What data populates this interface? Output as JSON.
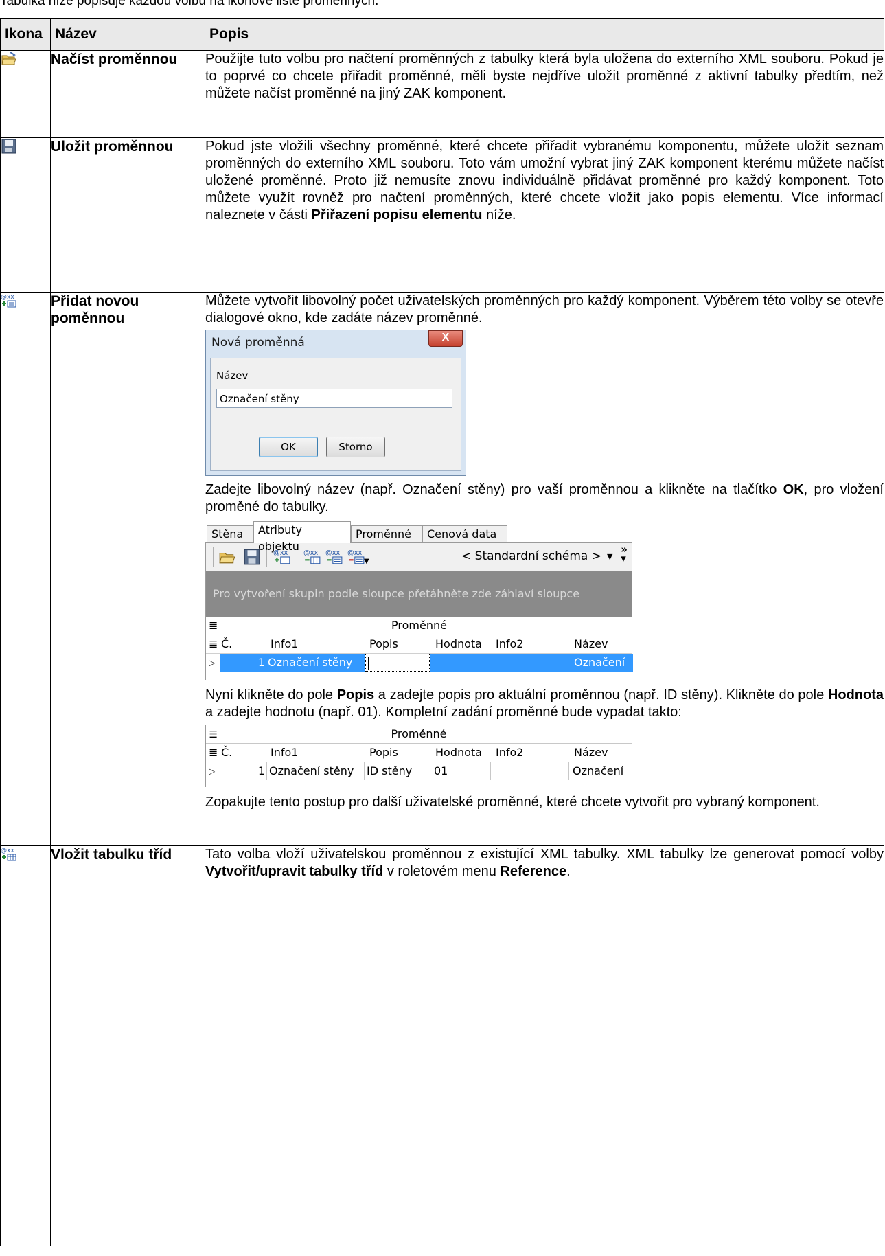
{
  "intro": "Tabulka níže popisuje každou volbu na ikonové liště proměnných.",
  "table": {
    "headers": [
      "Ikona",
      "Název",
      "Popis"
    ],
    "rows": [
      {
        "icon": "open-folder-icon",
        "name": "Načíst proměnnou",
        "desc": "Použijte tuto volbu pro načtení proměnných z tabulky která byla uložena do externího XML souboru. Pokud je to poprvé co chcete přiřadit proměnné, měli byste nejdříve uložit proměnné z aktivní tabulky předtím, než můžete načíst proměnné na jiný ZAK komponent."
      },
      {
        "icon": "save-disk-icon",
        "name": "Uložit proměnnou",
        "desc": "Pokud jste vložili všechny proměnné, které chcete přiřadit vybranému komponentu, můžete uložit seznam proměnných do externího XML souboru. Toto vám umožní vybrat jiný ZAK komponent kterému můžete načíst uložené proměnné. Proto již nemusíte znovu individuálně přidávat proměnné pro každý komponent. Toto můžete využít rovněž pro načtení proměnných, které chcete vložit jako popis elementu. Více informací naleznete v části ",
        "desc_bold": "Přiřazení popisu elementu",
        "desc_end": " níže."
      },
      {
        "icon": "add-variable-icon",
        "name": "Přidat novou poměnnou",
        "desc1": "Můžete vytvořit libovolný počet uživatelských proměnných pro každý komponent. Výběrem této volby se otevře dialogové okno, kde zadáte název proměnné.",
        "dialog": {
          "title": "Nová proměnná",
          "close": "X",
          "label": "Název",
          "value": "Označení stěny",
          "ok": "OK",
          "cancel": "Storno"
        },
        "desc2_a": "Zadejte libovolný název (např. Označení stěny) pro vaší proměnnou a klikněte na tlačítko ",
        "desc2_b": "OK",
        "desc2_c": ", pro vložení proměné do tabulky.",
        "panel": {
          "tabs": [
            "Stěna",
            "Atributy objektu",
            "Proměnné",
            "Cenová data"
          ],
          "scheme": "< Standardní schéma >",
          "group_hint": "Pro vytvoření skupin podle sloupce přetáhněte zde záhlaví sloupce",
          "band": "Proměnné",
          "columns": [
            "Č.",
            "Info1",
            "Popis",
            "Hodnota",
            "Info2",
            "Název"
          ],
          "row": [
            "1",
            "Označení stěny",
            "",
            "",
            "",
            "Označení"
          ]
        },
        "desc3_a": "Nyní klikněte do pole ",
        "desc3_b": "Popis",
        "desc3_c": " a zadejte popis pro aktuální proměnnou (např. ID stěny). Klikněte do pole ",
        "desc3_d": "Hodnota",
        "desc3_e": " a zadejte hodnotu (např. 01). Kompletní zadání proměnné bude vypadat takto:",
        "grid2": {
          "band": "Proměnné",
          "columns": [
            "Č.",
            "Info1",
            "Popis",
            "Hodnota",
            "Info2",
            "Název"
          ],
          "row": [
            "1",
            "Označení stěny",
            "ID stěny",
            "01",
            "",
            "Označení"
          ]
        },
        "desc4": "Zopakujte tento postup pro další uživatelské proměnné, které chcete vytvořit pro vybraný komponent."
      },
      {
        "icon": "insert-class-table-icon",
        "name": "Vložit tabulku tříd",
        "desc_a": "Tato volba vloží uživatelskou proměnnou z existující XML tabulky. XML tabulky lze generovat pomocí volby ",
        "desc_b": "Vytvořit/upravit tabulky tříd",
        "desc_c": " v roletovém menu ",
        "desc_d": "Reference",
        "desc_e": "."
      }
    ]
  },
  "colors": {
    "header_bg": "#e9e9e9",
    "selection": "#3399ff",
    "group_bar": "#8a8a8a"
  }
}
